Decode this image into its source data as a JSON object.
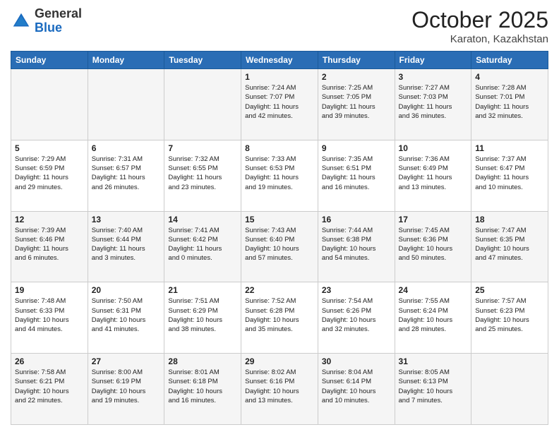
{
  "header": {
    "logo_general": "General",
    "logo_blue": "Blue",
    "month": "October 2025",
    "location": "Karaton, Kazakhstan"
  },
  "weekdays": [
    "Sunday",
    "Monday",
    "Tuesday",
    "Wednesday",
    "Thursday",
    "Friday",
    "Saturday"
  ],
  "rows": [
    [
      {
        "day": "",
        "info": ""
      },
      {
        "day": "",
        "info": ""
      },
      {
        "day": "",
        "info": ""
      },
      {
        "day": "1",
        "info": "Sunrise: 7:24 AM\nSunset: 7:07 PM\nDaylight: 11 hours\nand 42 minutes."
      },
      {
        "day": "2",
        "info": "Sunrise: 7:25 AM\nSunset: 7:05 PM\nDaylight: 11 hours\nand 39 minutes."
      },
      {
        "day": "3",
        "info": "Sunrise: 7:27 AM\nSunset: 7:03 PM\nDaylight: 11 hours\nand 36 minutes."
      },
      {
        "day": "4",
        "info": "Sunrise: 7:28 AM\nSunset: 7:01 PM\nDaylight: 11 hours\nand 32 minutes."
      }
    ],
    [
      {
        "day": "5",
        "info": "Sunrise: 7:29 AM\nSunset: 6:59 PM\nDaylight: 11 hours\nand 29 minutes."
      },
      {
        "day": "6",
        "info": "Sunrise: 7:31 AM\nSunset: 6:57 PM\nDaylight: 11 hours\nand 26 minutes."
      },
      {
        "day": "7",
        "info": "Sunrise: 7:32 AM\nSunset: 6:55 PM\nDaylight: 11 hours\nand 23 minutes."
      },
      {
        "day": "8",
        "info": "Sunrise: 7:33 AM\nSunset: 6:53 PM\nDaylight: 11 hours\nand 19 minutes."
      },
      {
        "day": "9",
        "info": "Sunrise: 7:35 AM\nSunset: 6:51 PM\nDaylight: 11 hours\nand 16 minutes."
      },
      {
        "day": "10",
        "info": "Sunrise: 7:36 AM\nSunset: 6:49 PM\nDaylight: 11 hours\nand 13 minutes."
      },
      {
        "day": "11",
        "info": "Sunrise: 7:37 AM\nSunset: 6:47 PM\nDaylight: 11 hours\nand 10 minutes."
      }
    ],
    [
      {
        "day": "12",
        "info": "Sunrise: 7:39 AM\nSunset: 6:46 PM\nDaylight: 11 hours\nand 6 minutes."
      },
      {
        "day": "13",
        "info": "Sunrise: 7:40 AM\nSunset: 6:44 PM\nDaylight: 11 hours\nand 3 minutes."
      },
      {
        "day": "14",
        "info": "Sunrise: 7:41 AM\nSunset: 6:42 PM\nDaylight: 11 hours\nand 0 minutes."
      },
      {
        "day": "15",
        "info": "Sunrise: 7:43 AM\nSunset: 6:40 PM\nDaylight: 10 hours\nand 57 minutes."
      },
      {
        "day": "16",
        "info": "Sunrise: 7:44 AM\nSunset: 6:38 PM\nDaylight: 10 hours\nand 54 minutes."
      },
      {
        "day": "17",
        "info": "Sunrise: 7:45 AM\nSunset: 6:36 PM\nDaylight: 10 hours\nand 50 minutes."
      },
      {
        "day": "18",
        "info": "Sunrise: 7:47 AM\nSunset: 6:35 PM\nDaylight: 10 hours\nand 47 minutes."
      }
    ],
    [
      {
        "day": "19",
        "info": "Sunrise: 7:48 AM\nSunset: 6:33 PM\nDaylight: 10 hours\nand 44 minutes."
      },
      {
        "day": "20",
        "info": "Sunrise: 7:50 AM\nSunset: 6:31 PM\nDaylight: 10 hours\nand 41 minutes."
      },
      {
        "day": "21",
        "info": "Sunrise: 7:51 AM\nSunset: 6:29 PM\nDaylight: 10 hours\nand 38 minutes."
      },
      {
        "day": "22",
        "info": "Sunrise: 7:52 AM\nSunset: 6:28 PM\nDaylight: 10 hours\nand 35 minutes."
      },
      {
        "day": "23",
        "info": "Sunrise: 7:54 AM\nSunset: 6:26 PM\nDaylight: 10 hours\nand 32 minutes."
      },
      {
        "day": "24",
        "info": "Sunrise: 7:55 AM\nSunset: 6:24 PM\nDaylight: 10 hours\nand 28 minutes."
      },
      {
        "day": "25",
        "info": "Sunrise: 7:57 AM\nSunset: 6:23 PM\nDaylight: 10 hours\nand 25 minutes."
      }
    ],
    [
      {
        "day": "26",
        "info": "Sunrise: 7:58 AM\nSunset: 6:21 PM\nDaylight: 10 hours\nand 22 minutes."
      },
      {
        "day": "27",
        "info": "Sunrise: 8:00 AM\nSunset: 6:19 PM\nDaylight: 10 hours\nand 19 minutes."
      },
      {
        "day": "28",
        "info": "Sunrise: 8:01 AM\nSunset: 6:18 PM\nDaylight: 10 hours\nand 16 minutes."
      },
      {
        "day": "29",
        "info": "Sunrise: 8:02 AM\nSunset: 6:16 PM\nDaylight: 10 hours\nand 13 minutes."
      },
      {
        "day": "30",
        "info": "Sunrise: 8:04 AM\nSunset: 6:14 PM\nDaylight: 10 hours\nand 10 minutes."
      },
      {
        "day": "31",
        "info": "Sunrise: 8:05 AM\nSunset: 6:13 PM\nDaylight: 10 hours\nand 7 minutes."
      },
      {
        "day": "",
        "info": ""
      }
    ]
  ]
}
